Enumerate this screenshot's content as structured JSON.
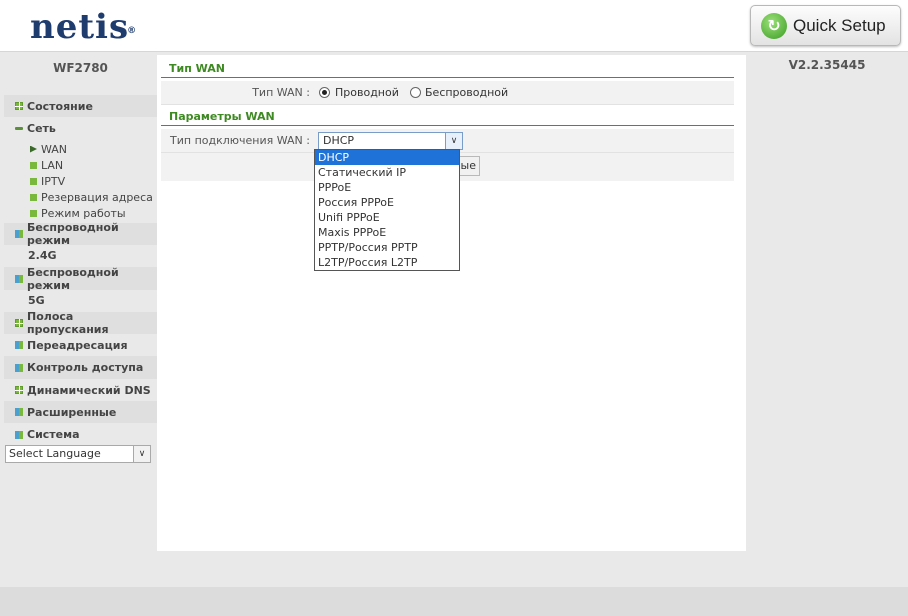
{
  "header": {
    "logo": "netis",
    "quick_setup_label": "Quick Setup"
  },
  "sidebar": {
    "model": "WF2780",
    "items": [
      {
        "label": "Состояние"
      },
      {
        "label": "Сеть",
        "sub": [
          "WAN",
          "LAN",
          "IPTV",
          "Резервация адреса",
          "Режим работы"
        ]
      },
      {
        "label": "Беспроводной режим",
        "line2": "2.4G"
      },
      {
        "label": "Беспроводной режим",
        "line2": "5G"
      },
      {
        "label": "Полоса пропускания"
      },
      {
        "label": "Переадресация"
      },
      {
        "label": "Контроль доступа"
      },
      {
        "label": "Динамический DNS"
      },
      {
        "label": "Расширенные"
      },
      {
        "label": "Система"
      }
    ],
    "language_select": "Select Language"
  },
  "version": "V2.2.35445",
  "content": {
    "wan_type": {
      "title": "Тип WAN",
      "label": "Тип WAN :",
      "option_wired": "Проводной",
      "option_wireless": "Беспроводной",
      "selected": "wired"
    },
    "wan_params": {
      "title": "Параметры WAN",
      "connection_label": "Тип подключения WAN :",
      "connection_value": "DHCP",
      "connection_options": [
        "DHCP",
        "Статический IP",
        "PPPoE",
        "Россия PPPoE",
        "Unifi PPPoE",
        "Maxis PPPoE",
        "PPTP/Россия PPTP",
        "L2TP/Россия L2TP"
      ],
      "hidden_button_text": "ные"
    }
  },
  "colors": {
    "accent_green": "#3e8a22",
    "logo_blue": "#1f3c6e",
    "selection_blue": "#1e72d8"
  }
}
